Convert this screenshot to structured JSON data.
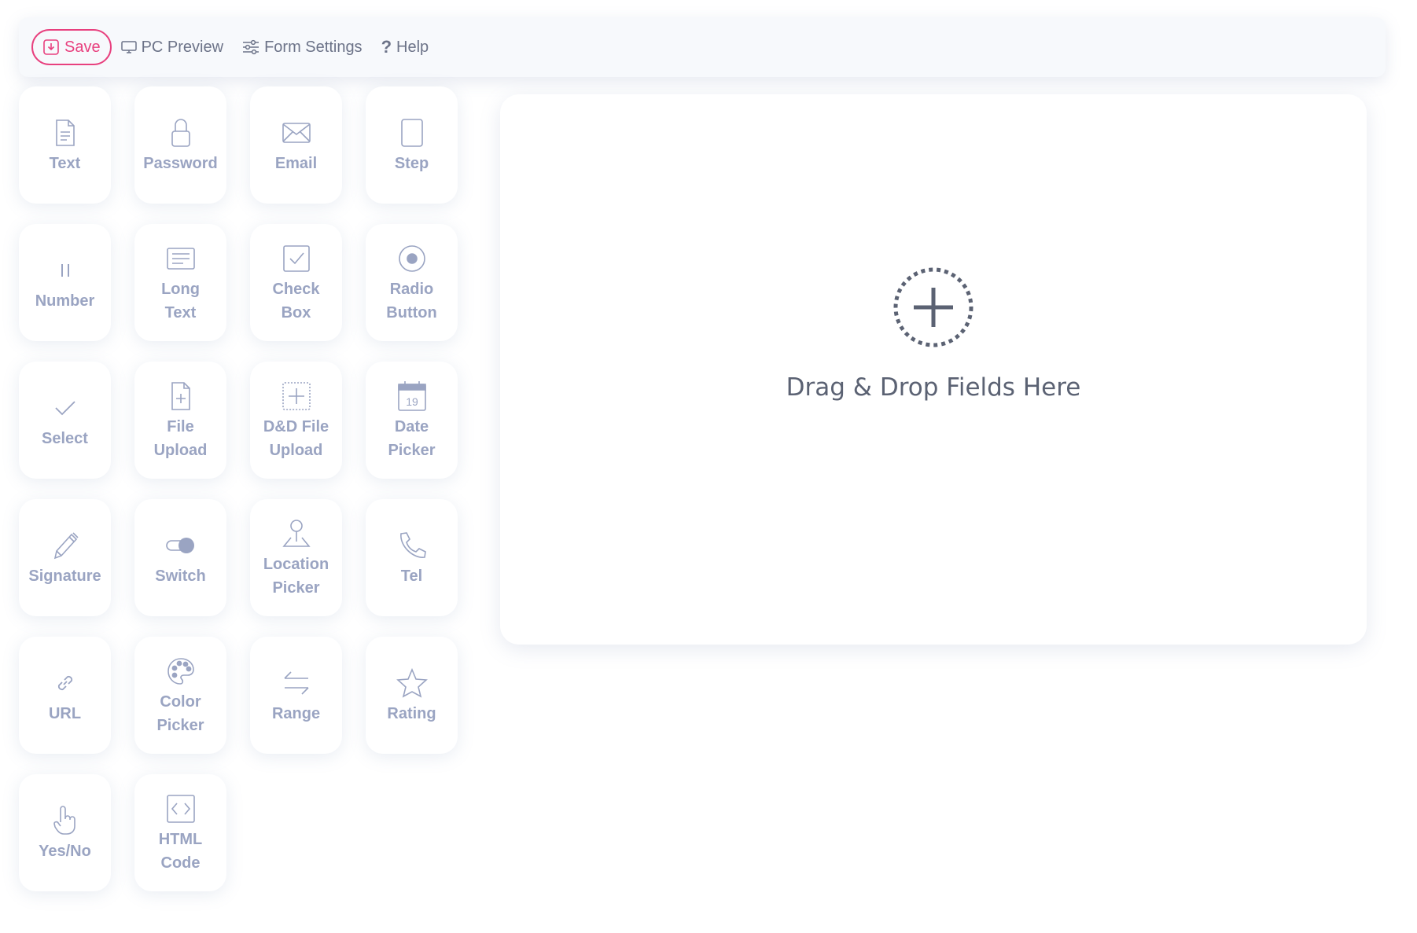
{
  "toolbar": {
    "save": "Save",
    "preview": "PC Preview",
    "settings": "Form Settings",
    "help": "Help"
  },
  "fields": [
    {
      "icon": "document-icon",
      "line1": "Text",
      "line2": ""
    },
    {
      "icon": "lock-icon",
      "line1": "Password",
      "line2": ""
    },
    {
      "icon": "envelope-icon",
      "line1": "Email",
      "line2": ""
    },
    {
      "icon": "step-icon",
      "line1": "Step",
      "line2": ""
    },
    {
      "icon": "number-icon",
      "line1": "Number",
      "line2": ""
    },
    {
      "icon": "long-text-icon",
      "line1": "Long",
      "line2": "Text"
    },
    {
      "icon": "checkbox-icon",
      "line1": "Check",
      "line2": "Box"
    },
    {
      "icon": "radio-icon",
      "line1": "Radio",
      "line2": "Button"
    },
    {
      "icon": "check-icon",
      "line1": "Select",
      "line2": ""
    },
    {
      "icon": "file-upload-icon",
      "line1": "File",
      "line2": "Upload"
    },
    {
      "icon": "dnd-upload-icon",
      "line1": "D&D File",
      "line2": "Upload"
    },
    {
      "icon": "calendar-icon",
      "line1": "Date",
      "line2": "Picker",
      "calendar_day": "19"
    },
    {
      "icon": "pen-icon",
      "line1": "Signature",
      "line2": ""
    },
    {
      "icon": "toggle-icon",
      "line1": "Switch",
      "line2": ""
    },
    {
      "icon": "location-pin-icon",
      "line1": "Location",
      "line2": "Picker"
    },
    {
      "icon": "phone-icon",
      "line1": "Tel",
      "line2": ""
    },
    {
      "icon": "link-icon",
      "line1": "URL",
      "line2": ""
    },
    {
      "icon": "palette-icon",
      "line1": "Color",
      "line2": "Picker"
    },
    {
      "icon": "range-arrows-icon",
      "line1": "Range",
      "line2": ""
    },
    {
      "icon": "star-icon",
      "line1": "Rating",
      "line2": ""
    },
    {
      "icon": "pointer-hand-icon",
      "line1": "Yes/No",
      "line2": ""
    },
    {
      "icon": "code-icon",
      "line1": "HTML",
      "line2": "Code"
    }
  ],
  "dropzone": {
    "text": "Drag & Drop Fields Here"
  },
  "colors": {
    "accent": "#e8407e",
    "tile_text": "#9aa4c2",
    "toolbar_text": "#6c7388"
  }
}
